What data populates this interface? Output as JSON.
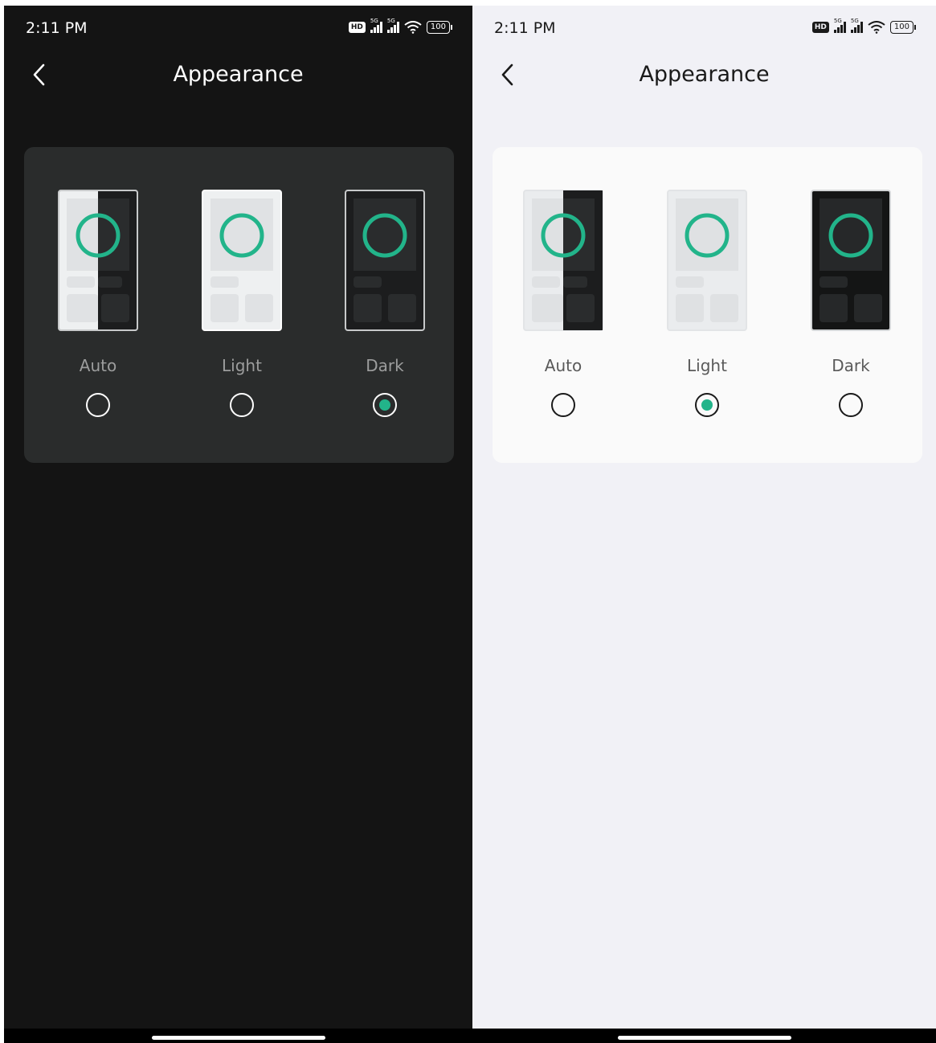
{
  "accent_color": "#22b48a",
  "screens": [
    {
      "theme": "dark",
      "status_bar": {
        "time": "2:11 PM",
        "hd_label": "HD",
        "signal_label": "5G",
        "battery": "100",
        "icons": [
          "hd-icon",
          "signal-5g-icon",
          "signal-5g-icon",
          "wifi-icon",
          "battery-icon"
        ]
      },
      "header": {
        "back_icon": "chevron-left-icon",
        "title": "Appearance"
      },
      "options": [
        {
          "label": "Auto",
          "selected": false
        },
        {
          "label": "Light",
          "selected": false
        },
        {
          "label": "Dark",
          "selected": true
        }
      ]
    },
    {
      "theme": "light",
      "status_bar": {
        "time": "2:11 PM",
        "hd_label": "HD",
        "signal_label": "5G",
        "battery": "100",
        "icons": [
          "hd-icon",
          "signal-5g-icon",
          "signal-5g-icon",
          "wifi-icon",
          "battery-icon"
        ]
      },
      "header": {
        "back_icon": "chevron-left-icon",
        "title": "Appearance"
      },
      "options": [
        {
          "label": "Auto",
          "selected": false
        },
        {
          "label": "Light",
          "selected": true
        },
        {
          "label": "Dark",
          "selected": false
        }
      ]
    }
  ]
}
